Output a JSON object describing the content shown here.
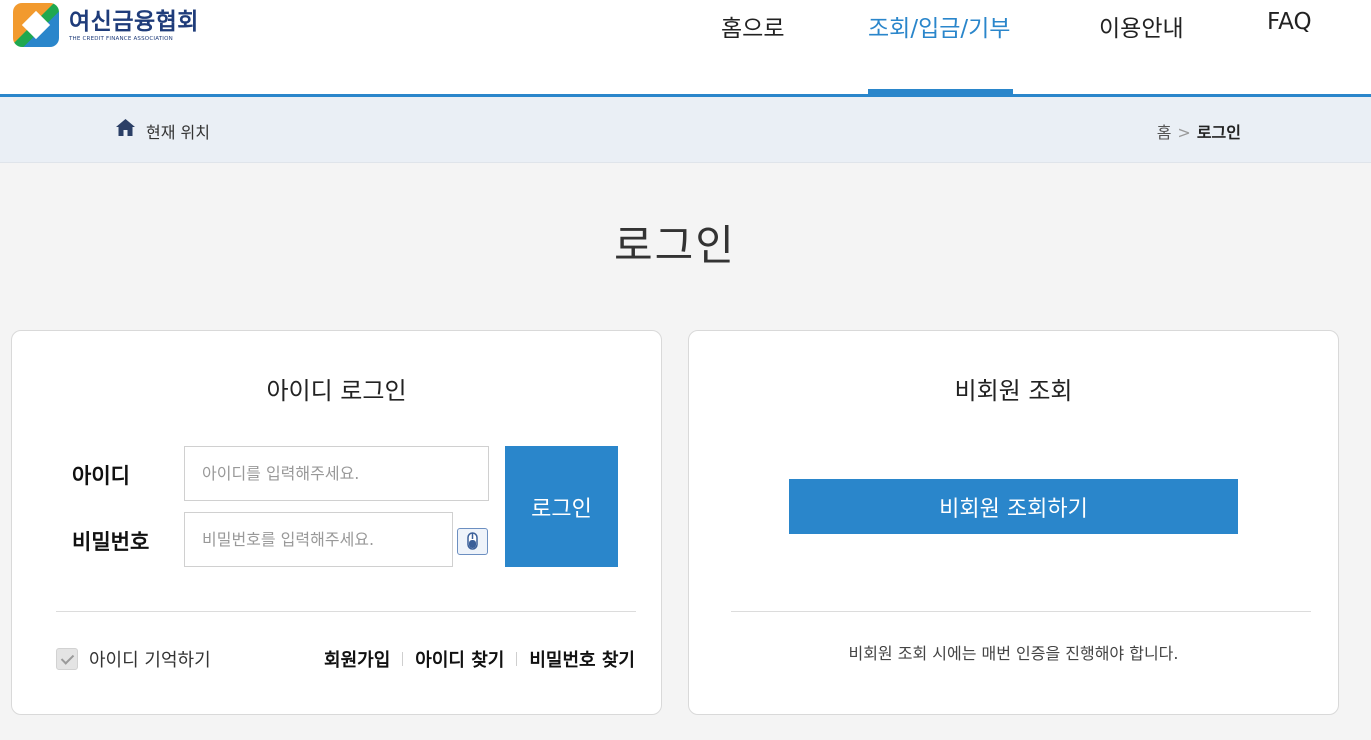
{
  "brand": {
    "name_ko": "여신금융협회",
    "name_en": "THE CREDIT FINANCE ASSOCIATION"
  },
  "nav": {
    "items": [
      {
        "label": "홈으로"
      },
      {
        "label": "조회/입금/기부",
        "active": true
      },
      {
        "label": "이용안내"
      },
      {
        "label": "FAQ"
      }
    ]
  },
  "breadcrumb": {
    "label": "현재 위치",
    "home": "홈",
    "separator": ">",
    "current": "로그인"
  },
  "page": {
    "title": "로그인"
  },
  "id_login": {
    "title": "아이디 로그인",
    "id_label": "아이디",
    "id_placeholder": "아이디를 입력해주세요.",
    "pw_label": "비밀번호",
    "pw_placeholder": "비밀번호를 입력해주세요.",
    "submit_label": "로그인",
    "remember_label": "아이디 기억하기",
    "remember_checked": true,
    "links": {
      "signup": "회원가입",
      "find_id": "아이디 찾기",
      "find_pw": "비밀번호 찾기"
    }
  },
  "guest": {
    "title": "비회원 조회",
    "button_label": "비회원 조회하기",
    "note": "비회원 조회 시에는 매번 인증을 진행해야 합니다."
  },
  "colors": {
    "accent": "#2a86cb",
    "brand_navy": "#1f3c7a"
  },
  "icons": {
    "home": "home-icon",
    "virtual_keyboard": "mouse-icon",
    "check": "check-icon"
  }
}
